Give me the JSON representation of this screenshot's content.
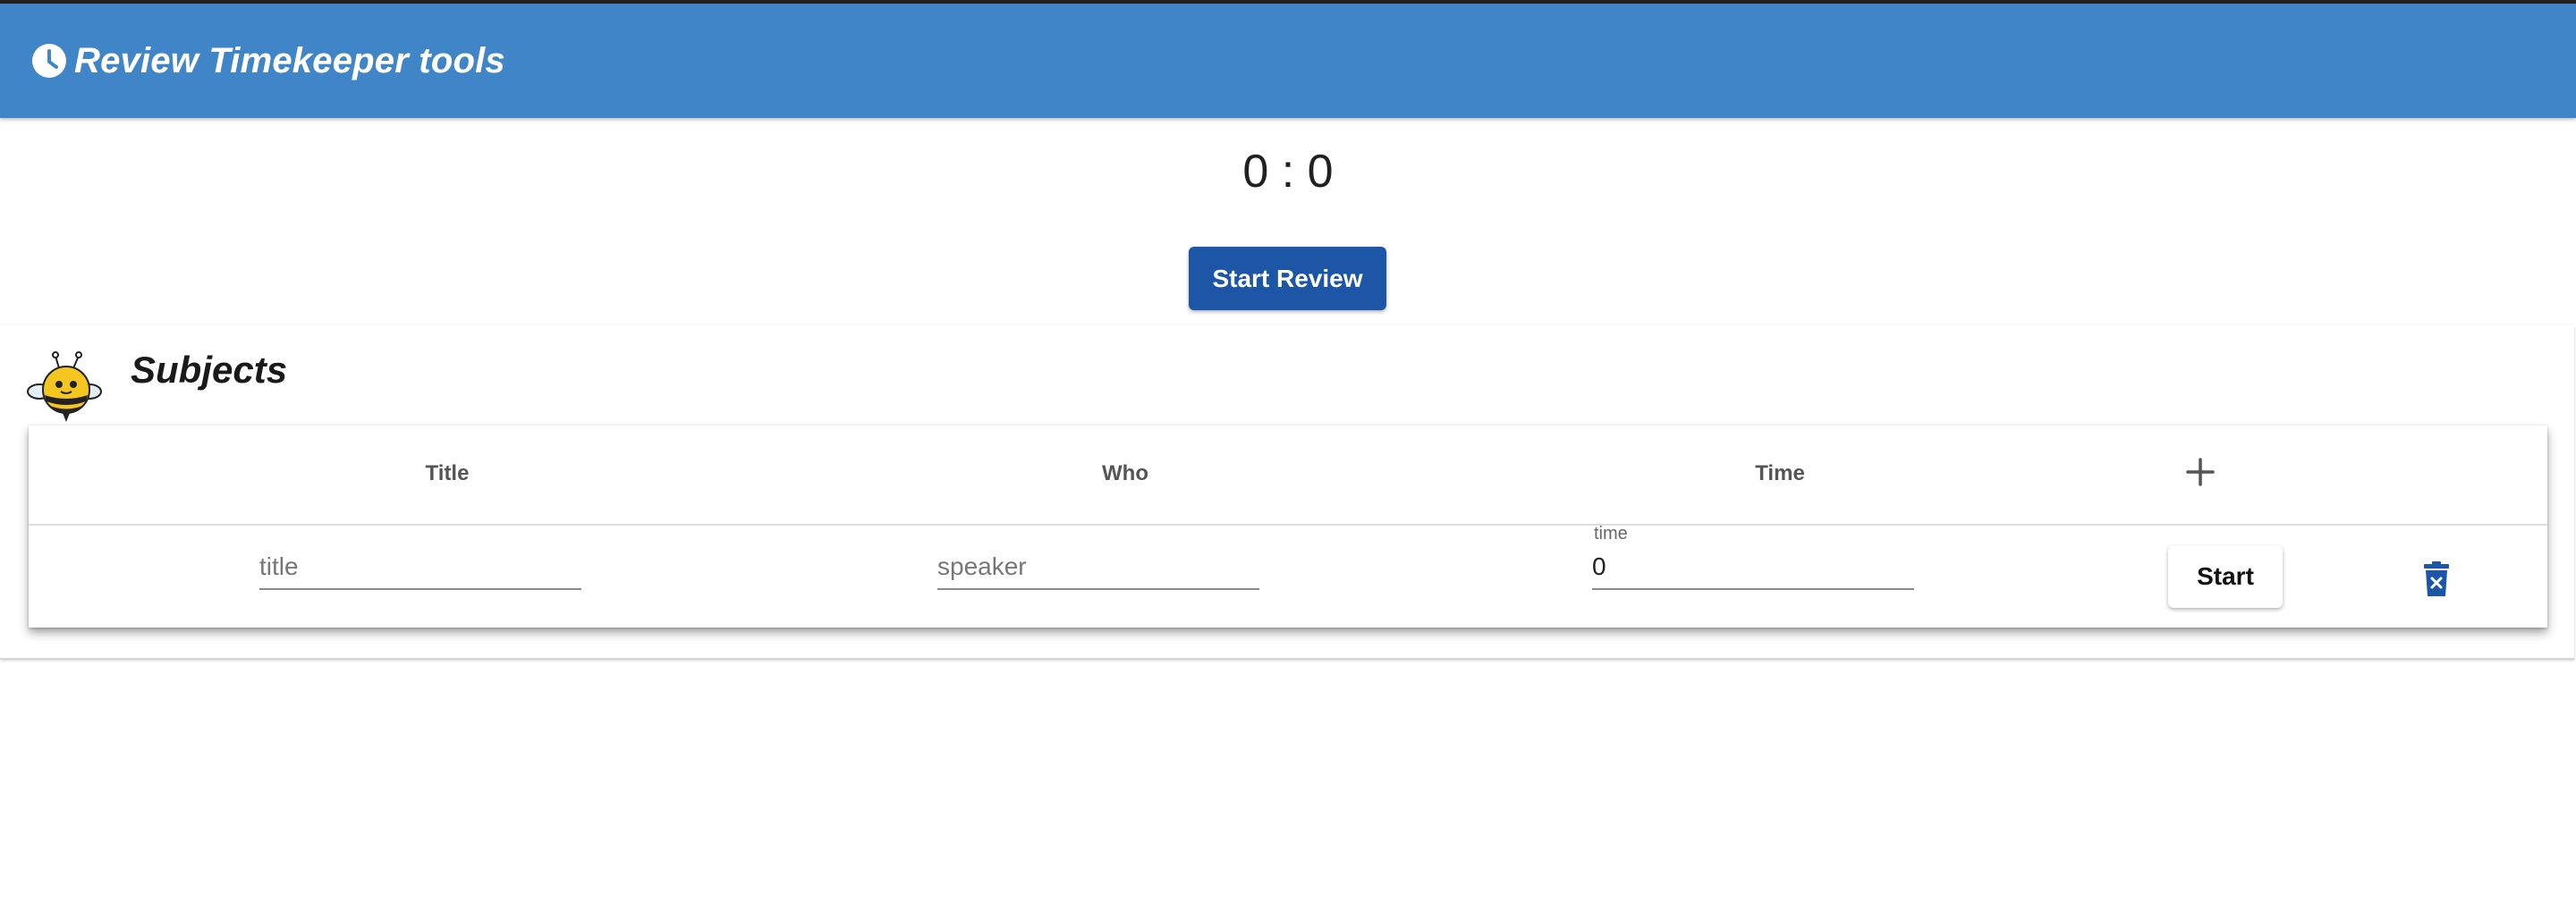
{
  "app": {
    "title": "Review Timekeeper tools",
    "accent_color": "#3f85c8",
    "icon": "clock-icon"
  },
  "timer": {
    "display": "0 : 0"
  },
  "review": {
    "start_label": "Start Review",
    "button_color": "#1d56a6"
  },
  "subjects": {
    "title": "Subjects",
    "icon": "bee-icon",
    "columns": [
      "Title",
      "Who",
      "Time"
    ],
    "add_icon": "plus-icon",
    "rows": [
      {
        "title_value": "",
        "title_placeholder": "title",
        "who_value": "",
        "who_placeholder": "speaker",
        "time_label": "time",
        "time_value": "0",
        "start_label": "Start",
        "delete_icon": "delete-icon"
      }
    ]
  }
}
